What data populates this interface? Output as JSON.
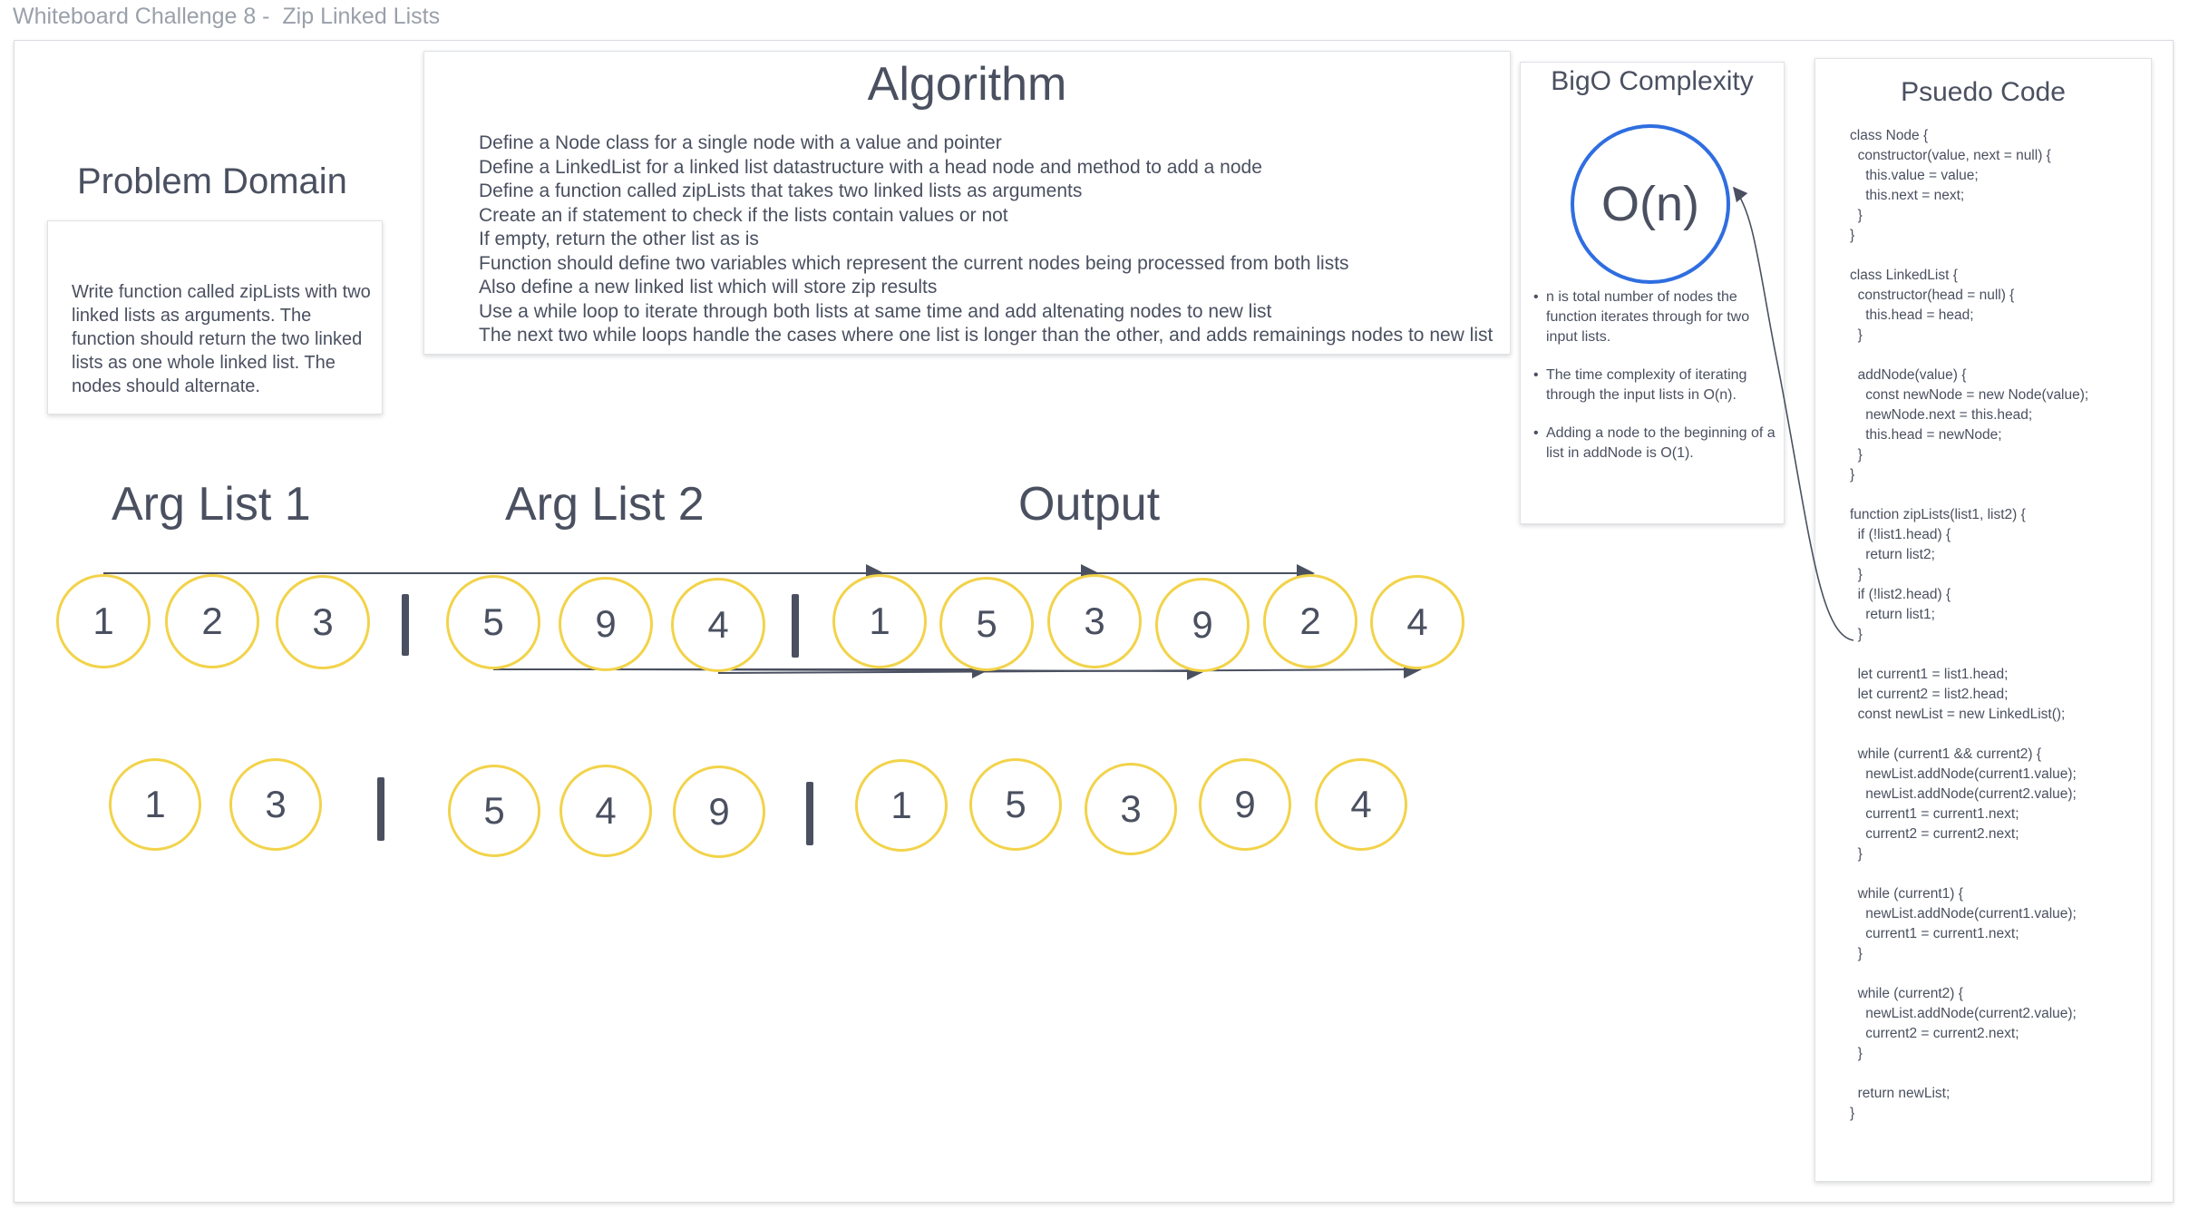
{
  "page_title": "Whiteboard Challenge 8 -  Zip Linked Lists",
  "problem_domain": {
    "heading": "Problem Domain",
    "text": "Write function called zipLists with two linked lists as arguments. The function should return the two linked lists as one whole linked list. The nodes should alternate."
  },
  "algorithm": {
    "title": "Algorithm",
    "steps": [
      "Define a Node class for a single node with a value and pointer",
      "Define a LinkedList for a linked list datastructure with a head node and method to add a node",
      "Define a function called zipLists that takes two linked lists as arguments",
      "Create an if statement to check if the lists contain values or not",
      "If empty, return the other list as is",
      "Function should define two variables which represent the current nodes being processed from both lists",
      "Also define a new linked list which will store zip results",
      "Use a while loop to iterate through both lists at same time and add altenating nodes to new list",
      "The next two while loops handle the cases where one list is longer than the other, and adds remainings nodes to new list"
    ]
  },
  "bigo": {
    "title": "BigO Complexity",
    "value": "O(n)",
    "notes": [
      "n is total number of nodes the function iterates through for two input lists.",
      "The time complexity of iterating through the input lists in O(n).",
      "Adding a node to the beginning of a list in addNode is O(1)."
    ]
  },
  "pseudo": {
    "title": "Psuedo Code",
    "code": "class Node {\n  constructor(value, next = null) {\n    this.value = value;\n    this.next = next;\n  }\n}\n\nclass LinkedList {\n  constructor(head = null) {\n    this.head = head;\n  }\n\n  addNode(value) {\n    const newNode = new Node(value);\n    newNode.next = this.head;\n    this.head = newNode;\n  }\n}\n\nfunction zipLists(list1, list2) {\n  if (!list1.head) {\n    return list2;\n  }\n  if (!list2.head) {\n    return list1;\n  }\n\n  let current1 = list1.head;\n  let current2 = list2.head;\n  const newList = new LinkedList();\n\n  while (current1 && current2) {\n    newList.addNode(current1.value);\n    newList.addNode(current2.value);\n    current1 = current1.next;\n    current2 = current2.next;\n  }\n\n  while (current1) {\n    newList.addNode(current1.value);\n    current1 = current1.next;\n  }\n\n  while (current2) {\n    newList.addNode(current2.value);\n    current2 = current2.next;\n  }\n\n  return newList;\n}"
  },
  "labels": {
    "arg1": "Arg List 1",
    "arg2": "Arg List 2",
    "output": "Output"
  },
  "example1": {
    "list1": [
      "1",
      "2",
      "3"
    ],
    "list2": [
      "5",
      "9",
      "4"
    ],
    "output": [
      "1",
      "5",
      "3",
      "9",
      "2",
      "4"
    ]
  },
  "example2": {
    "list1": [
      "1",
      "3"
    ],
    "list2": [
      "5",
      "4",
      "9"
    ],
    "output": [
      "1",
      "5",
      "3",
      "9",
      "4"
    ]
  },
  "colors": {
    "node_border": "#f2d34a",
    "bigo_circle": "#2f6ee0",
    "text": "#4a5060"
  }
}
